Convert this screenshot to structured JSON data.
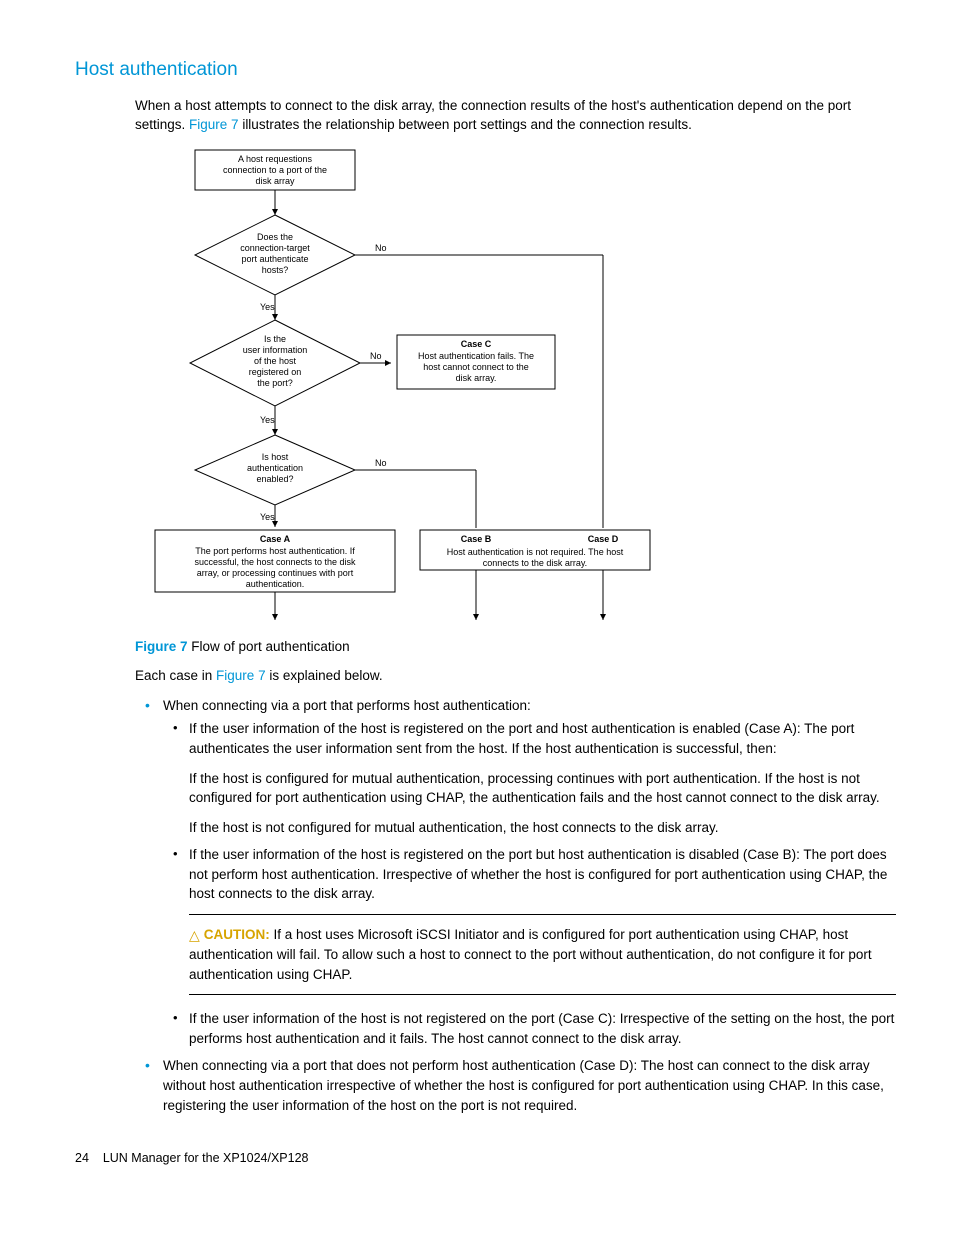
{
  "heading": "Host authentication",
  "intro_pre": "When a host attempts to connect to the disk array, the connection results of the host's authentication depend on the port settings. ",
  "intro_link": "Figure 7",
  "intro_post": " illustrates the relationship between port settings and the connection results.",
  "flow": {
    "start": "A host requestions connection to a port of the disk array",
    "dec1": "Does the connection-target port authenticate hosts?",
    "dec2": "Is the user information of the host registered on the port?",
    "dec3": "Is host authentication enabled?",
    "caseA_title": "Case A",
    "caseA": "The port performs host authentication. If successful, the host connects to the disk array, or processing continues with port authentication.",
    "caseB_title": "Case B",
    "caseD_title": "Case D",
    "caseBD": "Host authentication is not required. The host connects to the disk array.",
    "caseC_title": "Case C",
    "caseC": "Host authentication fails. The host cannot connect to the disk array.",
    "yes": "Yes",
    "no": "No"
  },
  "figcap_label": "Figure 7",
  "figcap_text": "  Flow of port authentication",
  "eachcase_pre": "Each case in ",
  "eachcase_link": "Figure 7",
  "eachcase_post": " is explained below.",
  "b1_intro": "When connecting via a port that performs host authentication:",
  "b1a_p1": "If the user information of the host is registered on the port and host authentication is enabled (Case A): The port authenticates the user information sent from the host. If the host authentication is successful, then:",
  "b1a_p2": "If the host is configured for mutual authentication, processing continues with port authentication. If the host is not configured for port authentication using CHAP, the authentication fails and the host cannot connect to the disk array.",
  "b1a_p3": "If the host is not configured for mutual authentication, the host connects to the disk array.",
  "b1b": "If the user information of the host is registered on the port but host authentication is disabled (Case B): The port does not perform host authentication. Irrespective of whether the host is configured for port authentication using CHAP, the host connects to the disk array.",
  "caution_label": "CAUTION:",
  "caution_text": "   If a host uses Microsoft iSCSI Initiator and is configured for port authentication using CHAP, host authentication will fail. To allow such a host to connect to the port without authentication, do not configure it for port authentication using CHAP.",
  "b1c": "If the user information of the host is not registered on the port (Case C): Irrespective of the setting on the host, the port performs host authentication and it fails. The host cannot connect to the disk array.",
  "b2": "When connecting via a port that does not perform host authentication (Case D): The host can connect to the disk array without host authentication irrespective of whether the host is configured for port authentication using CHAP. In this case, registering the user information of the host on the port is not required.",
  "footer_page": "24",
  "footer_title": "LUN Manager for the XP1024/XP128"
}
